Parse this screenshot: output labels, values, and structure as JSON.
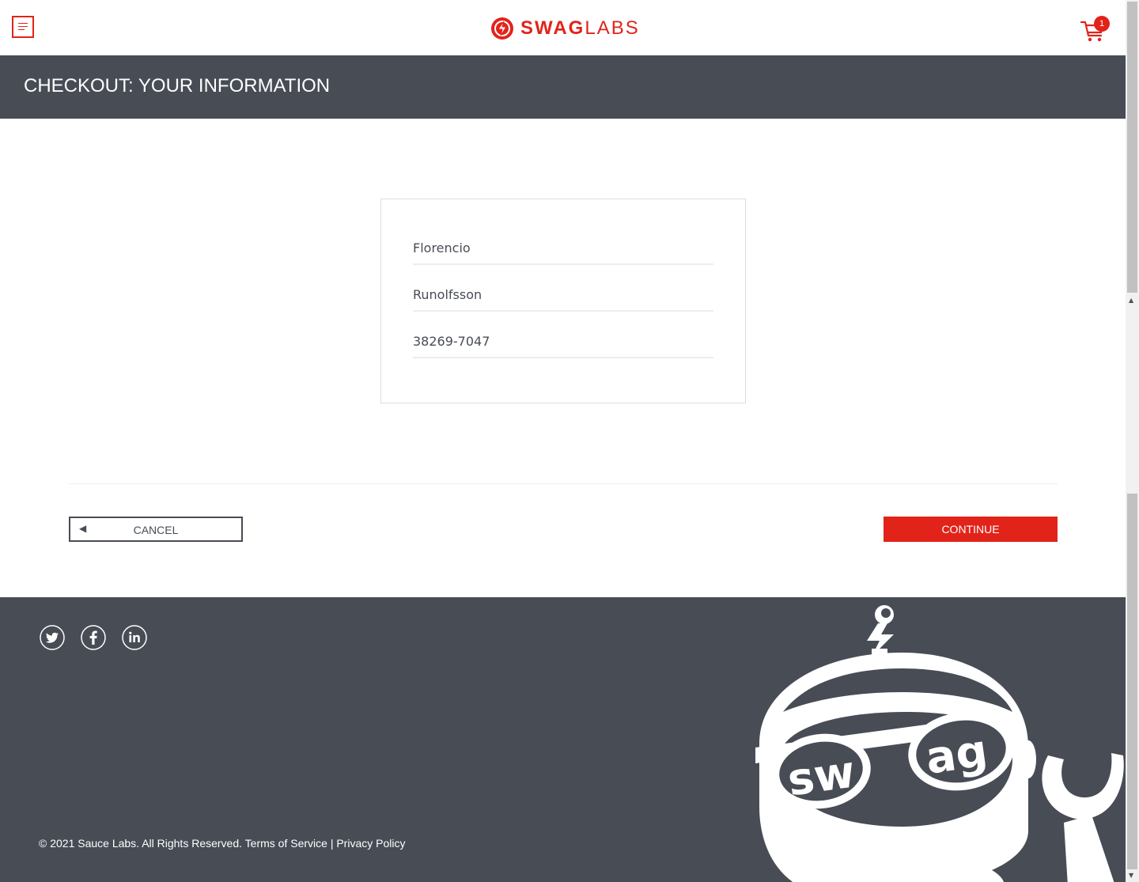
{
  "header": {
    "logo_bold": "SWAG",
    "logo_thin": "LABS",
    "cart_count": "1",
    "accent_color": "#e2231a"
  },
  "subheader": {
    "title": "CHECKOUT: YOUR INFORMATION"
  },
  "form": {
    "first_name": "Florencio",
    "last_name": "Runolfsson",
    "postal_code": "38269-7047"
  },
  "actions": {
    "cancel_label": "CANCEL",
    "continue_label": "CONTINUE"
  },
  "footer": {
    "copyright_text": "© 2021 Sauce Labs. All Rights Reserved.",
    "terms_label": "Terms of Service",
    "separator": "|",
    "privacy_label": "Privacy Policy",
    "social": [
      "twitter-icon",
      "facebook-icon",
      "linkedin-icon"
    ],
    "mascot_text_left": "sw",
    "mascot_text_right": "ag"
  }
}
